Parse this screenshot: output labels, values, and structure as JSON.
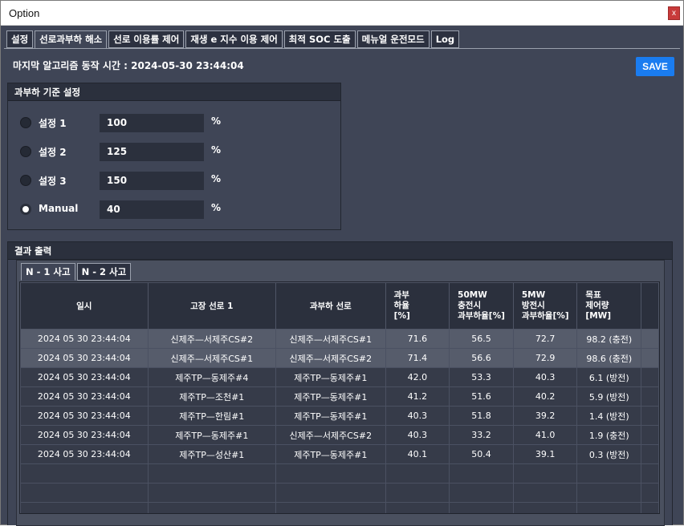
{
  "window": {
    "title": "Option",
    "close_label": "x"
  },
  "tabs": [
    {
      "label": "설정",
      "active": false
    },
    {
      "label": "선로과부하 해소",
      "active": true
    },
    {
      "label": "선로 이용률 제어",
      "active": false
    },
    {
      "label": "재생 e 지수 이용 제어",
      "active": false
    },
    {
      "label": "최적 SOC 도출",
      "active": false
    },
    {
      "label": "메뉴얼 운전모드",
      "active": false
    },
    {
      "label": "Log",
      "active": false
    }
  ],
  "last_run": "마지막 알고리즘 동작 시간 : 2024-05-30 23:44:04",
  "save_label": "SAVE",
  "overload": {
    "header": "과부하 기준 설정",
    "settings": [
      {
        "label": "설정 1",
        "value": "100",
        "unit": "%",
        "selected": false
      },
      {
        "label": "설정 2",
        "value": "125",
        "unit": "%",
        "selected": false
      },
      {
        "label": "설정 3",
        "value": "150",
        "unit": "%",
        "selected": false
      },
      {
        "label": "Manual",
        "value": "40",
        "unit": "%",
        "selected": true
      }
    ]
  },
  "result": {
    "header": "결과 출력",
    "tabs": [
      {
        "label": "N - 1 사고",
        "active": true
      },
      {
        "label": "N - 2 사고",
        "active": false
      }
    ],
    "columns": [
      [
        "일시"
      ],
      [
        "고장 선로 1"
      ],
      [
        "과부하 선로"
      ],
      [
        "과부",
        "하율",
        "[%]"
      ],
      [
        "50MW",
        "충전시",
        "과부하율[%]"
      ],
      [
        "5MW",
        "방전시",
        "과부하율[%]"
      ],
      [
        "목표",
        "제어량",
        "[MW]"
      ]
    ],
    "rows": [
      [
        "2024  05  30 23:44:04",
        "신제주—서제주CS#2",
        "신제주—서제주CS#1",
        "71.6",
        "56.5",
        "72.7",
        "98.2 (충전)"
      ],
      [
        "2024  05  30 23:44:04",
        "신제주—서제주CS#1",
        "신제주—서제주CS#2",
        "71.4",
        "56.6",
        "72.9",
        "98.6 (충전)"
      ],
      [
        "2024  05  30 23:44:04",
        "제주TP—동제주#4",
        "제주TP—동제주#1",
        "42.0",
        "53.3",
        "40.3",
        "6.1 (방전)"
      ],
      [
        "2024  05  30 23:44:04",
        "제주TP—조천#1",
        "제주TP—동제주#1",
        "41.2",
        "51.6",
        "40.2",
        "5.9 (방전)"
      ],
      [
        "2024  05  30 23:44:04",
        "제주TP—한림#1",
        "제주TP—동제주#1",
        "40.3",
        "51.8",
        "39.2",
        "1.4 (방전)"
      ],
      [
        "2024  05  30 23:44:04",
        "제주TP—동제주#1",
        "신제주—서제주CS#2",
        "40.3",
        "33.2",
        "41.0",
        "1.9 (충전)"
      ],
      [
        "2024  05  30 23:44:04",
        "제주TP—성산#1",
        "제주TP—동제주#1",
        "40.1",
        "50.4",
        "39.1",
        "0.3 (방전)"
      ]
    ]
  }
}
